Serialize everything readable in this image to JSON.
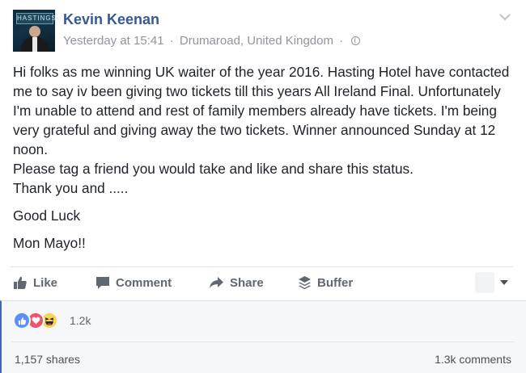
{
  "post": {
    "author": "Kevin Keenan",
    "avatar_sign_text": "HASTINGS",
    "timestamp": "Yesterday at 15:41",
    "separator": "·",
    "location": "Drumaroad, United Kingdom",
    "privacy_icon": "globe-icon",
    "menu_icon": "chevron-down-icon",
    "paragraph1": "Hi folks as me winning UK waiter of the year 2016. Hasting Hotel have contacted me to say iv been giving two tickets till this years All Ireland Final. Unfortunately I'm unable to attend and rest of family members already have tickets. I'm being very grateful and giving away the two tickets. Winner announced Sunday at 12 noon.",
    "paragraph2": "Please tag a friend you would take and like and share this status.",
    "paragraph3": "Thank you and .....",
    "paragraph4": "Good Luck",
    "paragraph5": "Mon Mayo!!"
  },
  "actions": {
    "like": "Like",
    "comment": "Comment",
    "share": "Share",
    "buffer": "Buffer"
  },
  "stats": {
    "reactions": [
      "like",
      "love",
      "haha"
    ],
    "reaction_count": "1.2k",
    "shares": "1,157 shares",
    "comments": "1.3k comments"
  },
  "colors": {
    "author_link": "#365899",
    "meta_gray": "#90949c",
    "action_gray": "#606770",
    "like_blue": "#5890ff",
    "love_red": "#f25268",
    "haha_yellow": "#fcd450",
    "accent_border": "#4267b2"
  }
}
